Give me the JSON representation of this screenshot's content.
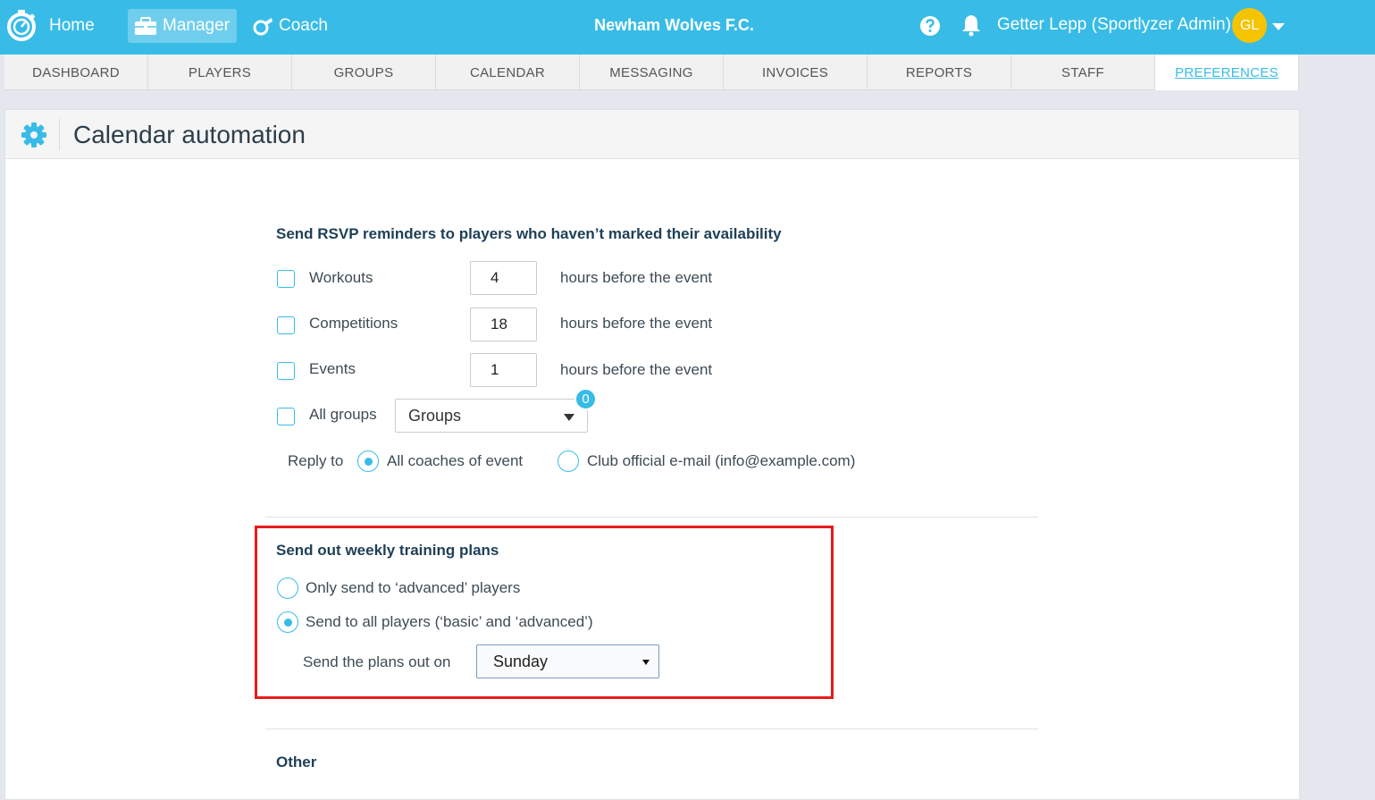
{
  "topbar": {
    "home_label": "Home",
    "manager_label": "Manager",
    "coach_label": "Coach",
    "club_name": "Newham Wolves F.C.",
    "user_name": "Getter Lepp (Sportlyzer Admin)",
    "user_initials": "GL"
  },
  "subnav": {
    "tabs": [
      "DASHBOARD",
      "PLAYERS",
      "GROUPS",
      "CALENDAR",
      "MESSAGING",
      "INVOICES",
      "REPORTS",
      "STAFF",
      "PREFERENCES"
    ],
    "active": "PREFERENCES"
  },
  "page": {
    "title": "Calendar automation"
  },
  "rsvp": {
    "title": "Send RSVP reminders to players who haven’t marked their availability",
    "rows": [
      {
        "label": "Workouts",
        "value": "4",
        "suffix": "hours before the event",
        "checked": false
      },
      {
        "label": "Competitions",
        "value": "18",
        "suffix": "hours before the event",
        "checked": false
      },
      {
        "label": "Events",
        "value": "1",
        "suffix": "hours before the event",
        "checked": false
      }
    ],
    "all_groups_label": "All groups",
    "groups_select": "Groups",
    "groups_count": "0",
    "reply_to_label": "Reply to",
    "reply_options": [
      "All coaches of event",
      "Club official e-mail (info@example.com)"
    ],
    "reply_selected": 0
  },
  "weekly": {
    "title": "Send out weekly training plans",
    "options": [
      "Only send to ‘advanced’ players",
      "Send to all players (‘basic’ and ‘advanced’)"
    ],
    "selected": 1,
    "day_label": "Send the plans out on",
    "day_value": "Sunday"
  },
  "other": {
    "title": "Other"
  },
  "colors": {
    "brand": "#38bce7",
    "highlight": "#e81c1c",
    "avatar": "#f5c400"
  }
}
